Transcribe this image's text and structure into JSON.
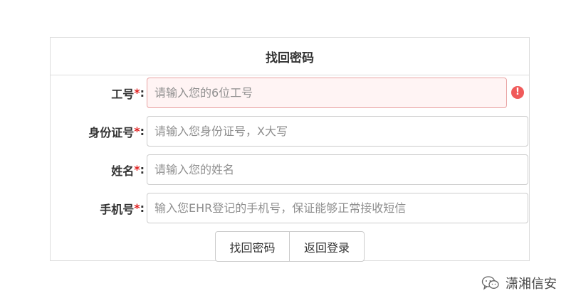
{
  "form": {
    "title": "找回密码",
    "fields": [
      {
        "label": "工号",
        "required_mark": "*",
        "colon": ":",
        "placeholder": "请输入您的6位工号",
        "value": ""
      },
      {
        "label": "身份证号",
        "required_mark": "*",
        "colon": ":",
        "placeholder": "请输入您身份证号，X大写",
        "value": ""
      },
      {
        "label": "姓名",
        "required_mark": "*",
        "colon": ":",
        "placeholder": "请输入您的姓名",
        "value": ""
      },
      {
        "label": "手机号",
        "required_mark": "*",
        "colon": ":",
        "placeholder": "输入您EHR登记的手机号，保证能够正常接收短信",
        "value": ""
      }
    ],
    "error_icon_glyph": "!",
    "buttons": {
      "submit_label": "找回密码",
      "back_label": "返回登录"
    }
  },
  "watermark": {
    "text": "潇湘信安",
    "icon": "wechat-icon"
  },
  "colors": {
    "required": "#e02020",
    "error_border": "#e8a3a3",
    "error_bg": "#fff4f4",
    "error_icon": "#f05a5a"
  }
}
